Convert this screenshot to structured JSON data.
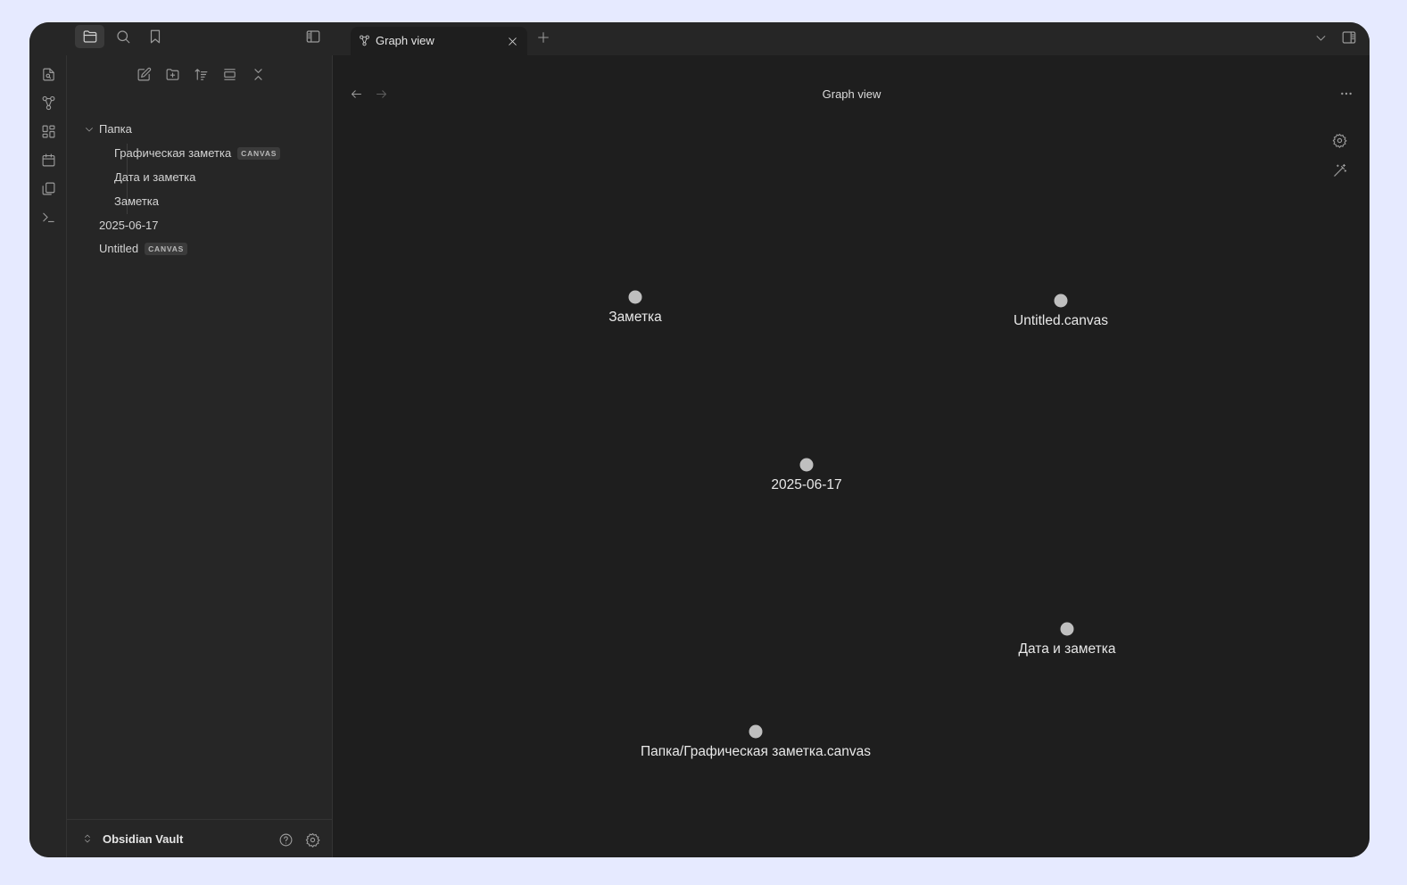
{
  "tab": {
    "label": "Graph view"
  },
  "view": {
    "title": "Graph view"
  },
  "explorer": {
    "folder": "Папка",
    "children": [
      {
        "label": "Графическая заметка",
        "badge": "CANVAS"
      },
      {
        "label": "Дата и заметка"
      },
      {
        "label": "Заметка"
      }
    ],
    "root_items": [
      {
        "label": "2025-06-17"
      },
      {
        "label": "Untitled",
        "badge": "CANVAS"
      }
    ]
  },
  "vault": {
    "name": "Obsidian Vault"
  },
  "graph": {
    "nodes": [
      {
        "label": "Заметка"
      },
      {
        "label": "Untitled.canvas"
      },
      {
        "label": "2025-06-17"
      },
      {
        "label": "Дата и заметка"
      },
      {
        "label": "Папка/Графическая заметка.canvas"
      }
    ]
  },
  "icons": {
    "top_left": [
      "folder-icon",
      "search-icon",
      "bookmark-icon",
      "sidebar-toggle-icon"
    ],
    "ribbon": [
      "open-quick-switcher-icon",
      "graph-icon",
      "canvas-icon",
      "calendar-icon",
      "templates-icon",
      "command-palette-icon"
    ],
    "explorer_toolbar": [
      "new-note-icon",
      "new-folder-icon",
      "sort-icon",
      "auto-reveal-icon",
      "collapse-all-icon"
    ]
  },
  "colors": {
    "background": "#1e1e1e",
    "panel": "#262626",
    "node": "#bfbfbf"
  }
}
